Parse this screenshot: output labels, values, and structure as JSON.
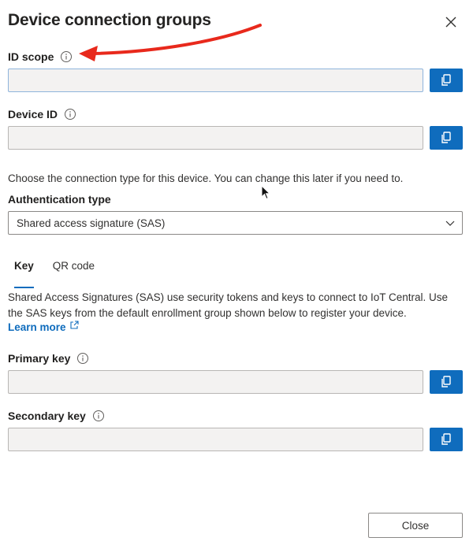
{
  "dialog": {
    "title": "Device connection groups",
    "close_icon": "close-icon"
  },
  "id_scope": {
    "label": "ID scope",
    "value": "",
    "info_icon": "info-icon",
    "copy_icon": "copy-icon"
  },
  "device_id": {
    "label": "Device ID",
    "value": "",
    "info_icon": "info-icon",
    "copy_icon": "copy-icon"
  },
  "connection_help": "Choose the connection type for this device. You can change this later if you need to.",
  "auth": {
    "label": "Authentication type",
    "selected": "Shared access signature (SAS)",
    "chevron_icon": "chevron-down-icon"
  },
  "tabs": [
    {
      "label": "Key",
      "active": true
    },
    {
      "label": "QR code",
      "active": false
    }
  ],
  "sas_description": "Shared Access Signatures (SAS) use security tokens and keys to connect to IoT Central. Use the SAS keys from the default enrollment group shown below to register your device.",
  "learn_more": {
    "label": "Learn more",
    "icon": "external-link-icon"
  },
  "primary_key": {
    "label": "Primary key",
    "value": "",
    "info_icon": "info-icon",
    "copy_icon": "copy-icon"
  },
  "secondary_key": {
    "label": "Secondary key",
    "value": "",
    "info_icon": "info-icon",
    "copy_icon": "copy-icon"
  },
  "footer": {
    "close_label": "Close"
  },
  "colors": {
    "accent": "#0f6cbd",
    "annotation_arrow": "#e8291c",
    "input_background": "#f3f2f1"
  }
}
